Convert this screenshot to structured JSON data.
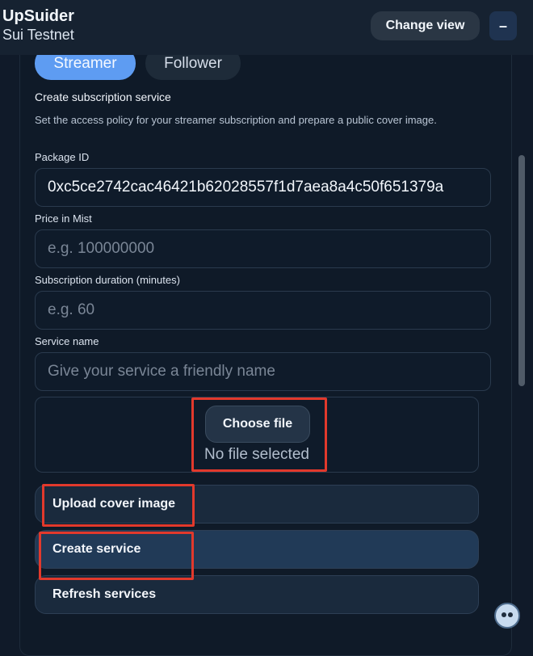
{
  "header": {
    "app_name": "UpSuider",
    "network": "Sui Testnet",
    "change_view_label": "Change view",
    "minimize_label": "–"
  },
  "tabs": [
    {
      "label": "Streamer",
      "active": true
    },
    {
      "label": "Follower",
      "active": false
    }
  ],
  "form": {
    "heading": "Create subscription service",
    "description": "Set the access policy for your streamer subscription and prepare a public cover image.",
    "package_id": {
      "label": "Package ID",
      "value": "0xc5ce2742cac46421b62028557f1d7aea8a4c50f651379a"
    },
    "price": {
      "label": "Price in Mist",
      "placeholder": "e.g. 100000000"
    },
    "duration": {
      "label": "Subscription duration (minutes)",
      "placeholder": "e.g. 60"
    },
    "service_name": {
      "label": "Service name",
      "placeholder": "Give your service a friendly name"
    },
    "file": {
      "button_label": "Choose file",
      "status": "No file selected"
    }
  },
  "actions": {
    "upload_cover": "Upload cover image",
    "create_service": "Create service",
    "refresh_services": "Refresh services"
  },
  "colors": {
    "accent": "#5e9cf2",
    "highlight": "#e2392c",
    "background": "#101a29"
  },
  "icons": {
    "assistant": "droplet-face-icon"
  }
}
